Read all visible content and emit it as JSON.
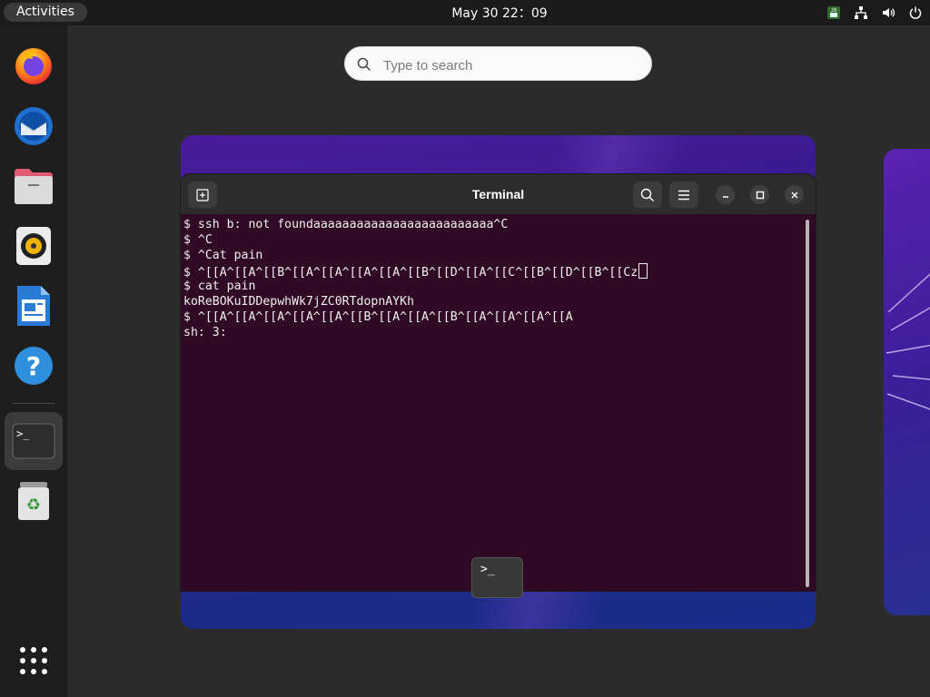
{
  "topbar": {
    "activities_label": "Activities",
    "clock": "May 30  22：09",
    "tray_icons": [
      "indicator-icon",
      "network-icon",
      "volume-icon",
      "power-icon"
    ]
  },
  "dock": {
    "apps": [
      "firefox-icon",
      "thunderbird-icon",
      "files-icon",
      "rhythmbox-icon",
      "writer-icon",
      "help-icon",
      "terminal-icon",
      "trash-icon"
    ],
    "show_apps_icon": "app-grid-icon"
  },
  "search": {
    "placeholder": "Type to search"
  },
  "terminal": {
    "title": "Terminal",
    "lines": [
      "$ ssh b: not foundaaaaaaaaaaaaaaaaaaaaaaaaa^C",
      "$ ^C",
      "$ ^Cat pain",
      "$ ^[[A^[[A^[[B^[[A^[[A^[[A^[[A^[[B^[[D^[[A^[[C^[[B^[[D^[[B^[[Cz",
      "$ cat pain",
      "koReBOKuIDDepwhWk7jZC0RTdopnAYKh",
      "$ ^[[A^[[A^[[A^[[A^[[A^[[B^[[A^[[A^[[B^[[A^[[A^[[A^[[A",
      "sh: 3:"
    ],
    "prompt_icon": ">_"
  },
  "colors": {
    "terminal_bg": "#300a24",
    "header_bg": "#2c2c2c",
    "accent": "#e95420"
  }
}
